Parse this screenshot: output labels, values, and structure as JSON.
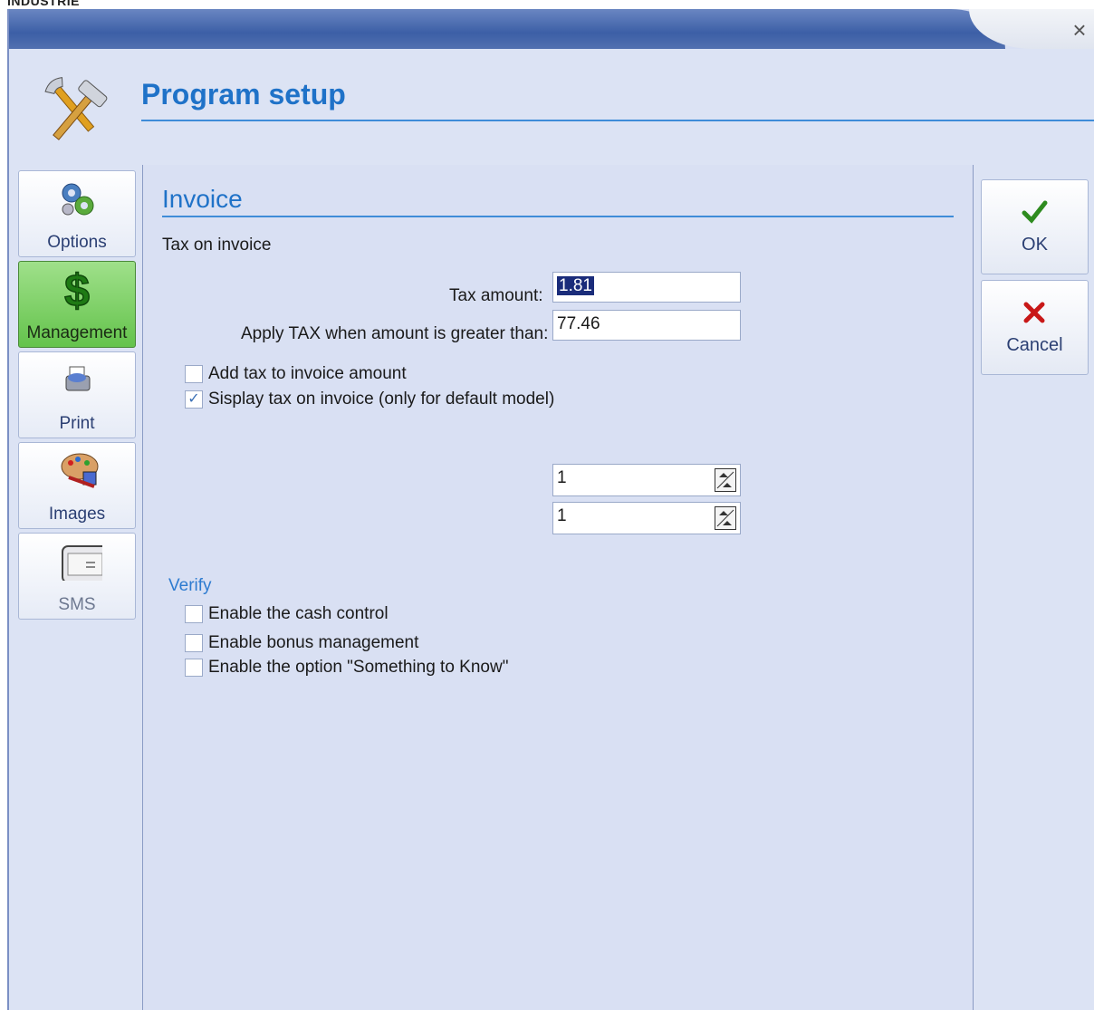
{
  "page_top_label": "INDUSTRIE",
  "window": {
    "close_glyph": "×"
  },
  "header": {
    "title": "Program setup",
    "icon": "tools-icon"
  },
  "sidebar": {
    "items": [
      {
        "label": "Options",
        "icon": "options-gears-icon",
        "state": "normal"
      },
      {
        "label": "Management",
        "icon": "dollar-icon",
        "state": "active"
      },
      {
        "label": "Print",
        "icon": "printer-icon",
        "state": "normal"
      },
      {
        "label": "Images",
        "icon": "palette-icon",
        "state": "normal"
      },
      {
        "label": "SMS",
        "icon": "sms-device-icon",
        "state": "disabled"
      }
    ]
  },
  "main": {
    "section_title": "Invoice",
    "subtitle": "Tax on invoice",
    "tax_amount": {
      "label": "Tax amount:",
      "value": "1.81"
    },
    "apply_tax": {
      "label": "Apply TAX when amount is greater than:",
      "value": "77.46"
    },
    "checkboxes": [
      {
        "label": "Add tax to invoice amount",
        "checked": false
      },
      {
        "label": "Sisplay tax on invoice (only for default model)",
        "checked": true
      }
    ],
    "spinners": [
      {
        "value": "1"
      },
      {
        "value": "1"
      }
    ],
    "verify": {
      "title": "Verify",
      "options": [
        {
          "label": "Enable the cash control",
          "checked": false
        },
        {
          "label": "Enable bonus management",
          "checked": false
        },
        {
          "label": "Enable the option \"Something to Know\"",
          "checked": false
        }
      ]
    }
  },
  "actions": {
    "ok": {
      "label": "OK",
      "icon": "check-icon",
      "color": "#2e8b1f"
    },
    "cancel": {
      "label": "Cancel",
      "icon": "x-icon",
      "color": "#c81818"
    }
  },
  "colors": {
    "accent": "#1f72c8",
    "active_nav": "#64c34c",
    "window_bg": "#d9e0f3"
  }
}
